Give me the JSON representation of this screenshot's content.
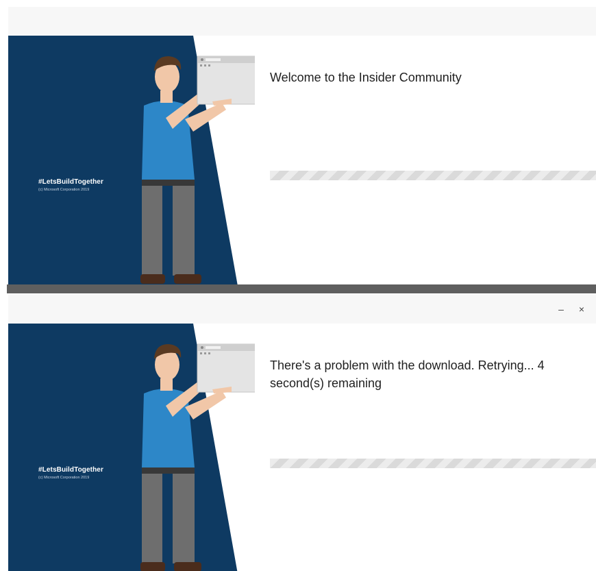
{
  "windows": [
    {
      "message": "Welcome to the Insider Community",
      "hashtag": "#LetsBuildTogether",
      "copyright": "(c) Microsoft Corporation 2019",
      "progress_fraction": 0
    },
    {
      "message": "There's a problem with the download. Retrying... 4 second(s) remaining",
      "hashtag": "#LetsBuildTogether",
      "copyright": "(c) Microsoft Corporation 2019",
      "progress_fraction": 0,
      "controls": {
        "minimize": "–",
        "close": "×"
      }
    }
  ],
  "colors": {
    "panel": "#0e3a62",
    "shirt": "#2d87c8",
    "pants": "#6e6e6e",
    "hair": "#5a3a22",
    "skin": "#f1c7a8",
    "shoes": "#4a2c1c"
  }
}
